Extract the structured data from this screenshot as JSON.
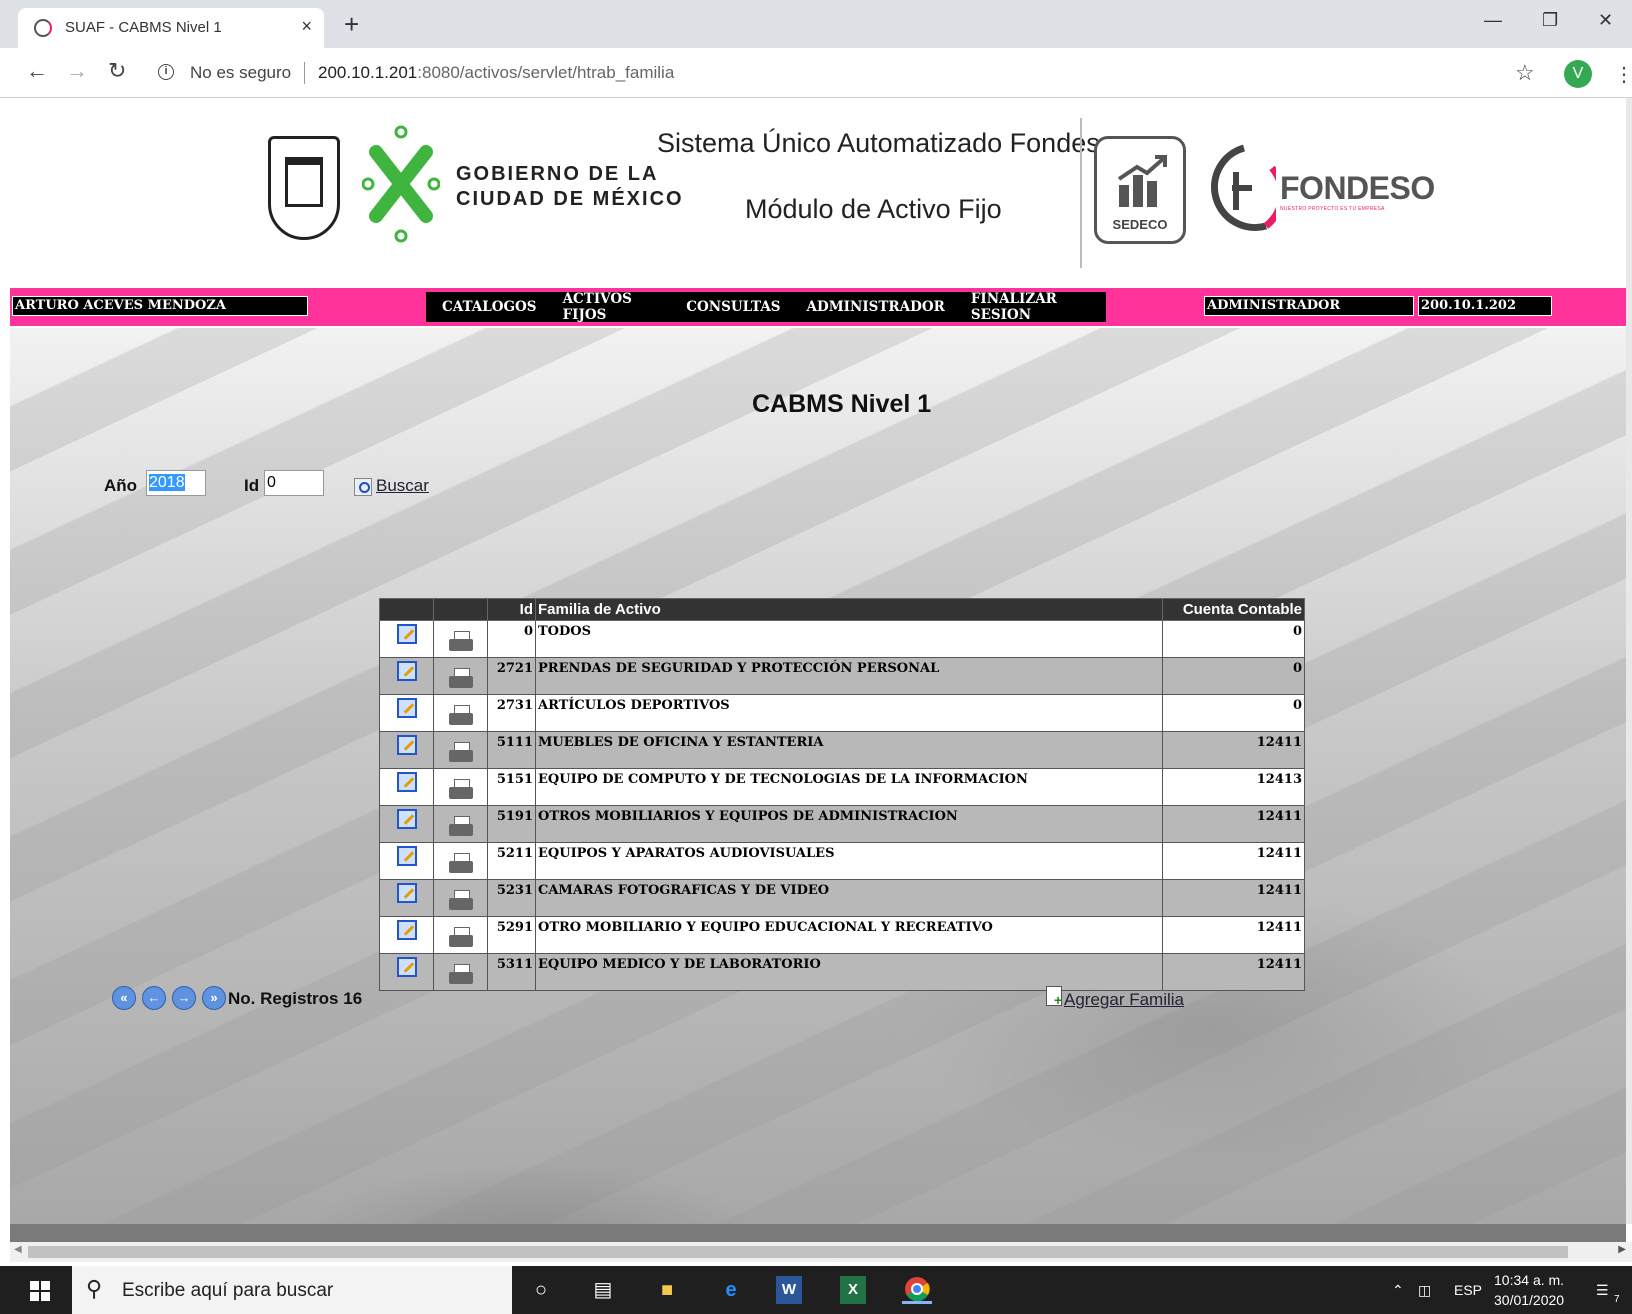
{
  "browser": {
    "tab_title": "SUAF - CABMS Nivel 1",
    "close_glyph": "×",
    "new_tab_glyph": "+",
    "security_label": "No es seguro",
    "url_host": "200.10.1.201",
    "url_rest": ":8080/activos/servlet/htrab_familia",
    "profile_initial": "V"
  },
  "header": {
    "gob_line1": "GOBIERNO DE LA",
    "gob_line2": "CIUDAD DE MÉXICO",
    "system_title": "Sistema Único Automatizado Fondeso",
    "module_title": "Módulo de Activo Fijo",
    "sedeco_label": "SEDECO",
    "fondeso_label": "FONDESO",
    "fondeso_tagline": "NUESTRO PROYECTO ES TU EMPRESA"
  },
  "navbar": {
    "user_name": "ARTURO ACEVES MENDOZA",
    "menu": [
      "CATALOGOS",
      "ACTIVOS FIJOS",
      "CONSULTAS",
      "ADMINISTRADOR",
      "FINALIZAR SESION"
    ],
    "role": "ADMINISTRADOR",
    "ip": "200.10.1.202",
    "color": "#ff3399"
  },
  "page": {
    "title": "CABMS Nivel 1",
    "year_label": "Año",
    "year_value": "2018",
    "id_label": "Id",
    "id_value": "0",
    "search_label": "Buscar"
  },
  "table": {
    "headers": {
      "blank1": "",
      "blank2": "",
      "id": "Id",
      "family": "Familia de Activo",
      "account": "Cuenta Contable"
    },
    "rows": [
      {
        "id": "0",
        "family": "TODOS",
        "account": "0"
      },
      {
        "id": "2721",
        "family": "PRENDAS DE SEGURIDAD Y PROTECCIÓN PERSONAL",
        "account": "0"
      },
      {
        "id": "2731",
        "family": "ARTÍCULOS DEPORTIVOS",
        "account": "0"
      },
      {
        "id": "5111",
        "family": "MUEBLES DE OFICINA Y ESTANTERIA",
        "account": "12411"
      },
      {
        "id": "5151",
        "family": "EQUIPO DE COMPUTO Y DE TECNOLOGIAS DE LA INFORMACION",
        "account": "12413"
      },
      {
        "id": "5191",
        "family": "OTROS MOBILIARIOS Y EQUIPOS DE ADMINISTRACION",
        "account": "12411"
      },
      {
        "id": "5211",
        "family": "EQUIPOS Y APARATOS AUDIOVISUALES",
        "account": "12411"
      },
      {
        "id": "5231",
        "family": "CAMARAS FOTOGRAFICAS Y DE VIDEO",
        "account": "12411"
      },
      {
        "id": "5291",
        "family": "OTRO MOBILIARIO Y EQUIPO EDUCACIONAL Y RECREATIVO",
        "account": "12411"
      },
      {
        "id": "5311",
        "family": "EQUIPO MEDICO Y DE LABORATORIO",
        "account": "12411"
      }
    ]
  },
  "footer": {
    "pager_glyphs": [
      "«",
      "←",
      "→",
      "»"
    ],
    "records_label": "No. Registros 16",
    "add_label": "Agregar Familia"
  },
  "taskbar": {
    "search_placeholder": "Escribe aquí para buscar",
    "language": "ESP",
    "time": "10:34 a. m.",
    "date": "30/01/2020",
    "notification_count": "7"
  }
}
